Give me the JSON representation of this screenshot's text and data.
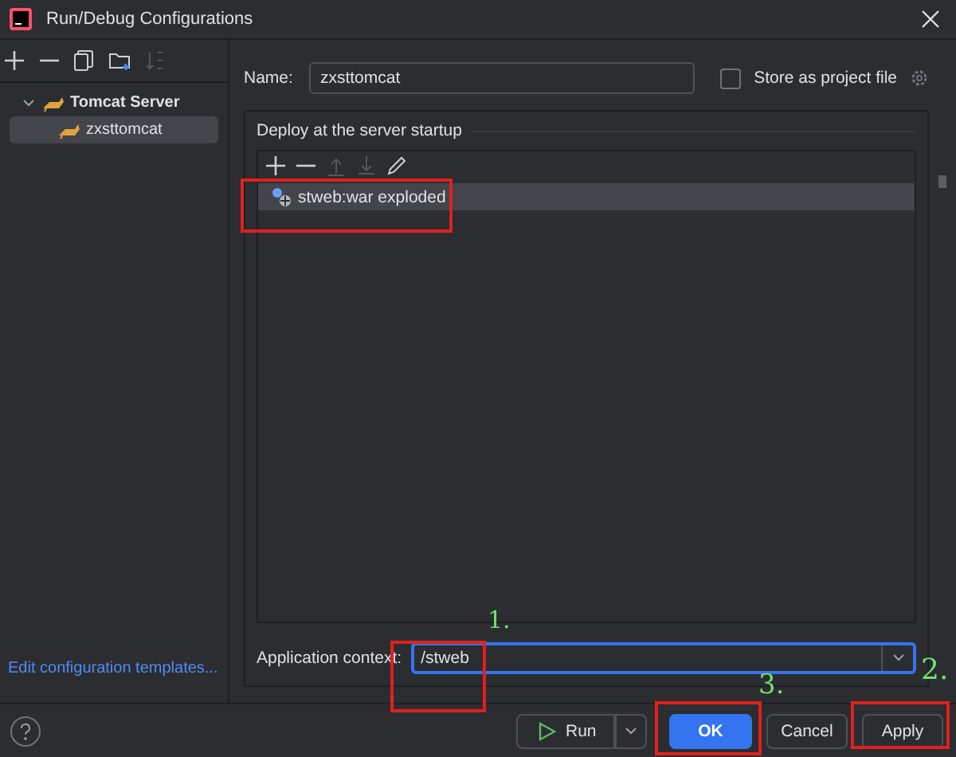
{
  "window": {
    "title": "Run/Debug Configurations"
  },
  "sidebar": {
    "toolbar": [
      {
        "kind": "add",
        "disabled": false
      },
      {
        "kind": "remove",
        "disabled": false
      },
      {
        "kind": "copy",
        "disabled": false
      },
      {
        "kind": "folder",
        "disabled": false
      },
      {
        "kind": "sort",
        "disabled": true
      }
    ],
    "items": [
      {
        "label": "Tomcat Server",
        "expanded": true,
        "selected": false,
        "children": [
          {
            "label": "zxsttomcat",
            "selected": true
          }
        ]
      }
    ],
    "footer_link": "Edit configuration templates..."
  },
  "name_field": {
    "label": "Name:",
    "value": "zxsttomcat"
  },
  "store_as_project_file": {
    "label": "Store as project file",
    "checked": false
  },
  "deploy": {
    "title": "Deploy at the server startup",
    "toolbar": [
      {
        "kind": "add",
        "disabled": false
      },
      {
        "kind": "remove",
        "disabled": false
      },
      {
        "kind": "up",
        "disabled": true
      },
      {
        "kind": "down",
        "disabled": true
      },
      {
        "kind": "edit",
        "disabled": false
      }
    ],
    "artifacts": [
      {
        "label": "stweb:war exploded",
        "selected": true
      }
    ]
  },
  "application_context": {
    "label": "Application context:",
    "value": "/stweb"
  },
  "buttons": [
    {
      "label": "Run",
      "kind": "run"
    },
    {
      "label": "OK",
      "kind": "primary"
    },
    {
      "label": "Cancel",
      "kind": "plain"
    },
    {
      "label": "Apply",
      "kind": "plain"
    }
  ],
  "annotations": [
    {
      "text": "1."
    },
    {
      "text": "2."
    },
    {
      "text": "3."
    }
  ]
}
